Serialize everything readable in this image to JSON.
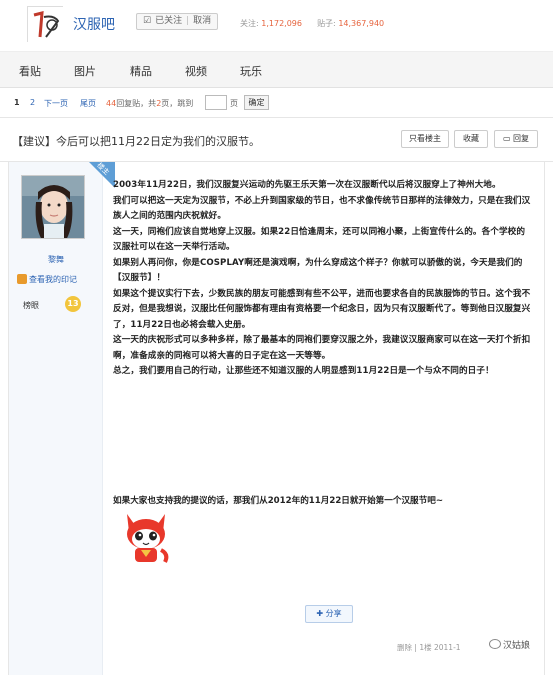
{
  "header": {
    "bar_name": "汉服吧",
    "follow_label": "已关注",
    "unfollow_label": "取消",
    "follow_count_label": "关注:",
    "follow_count": "1,172,096",
    "post_count_label": "贴子:",
    "post_count": "14,367,940",
    "logo_text": "汉服"
  },
  "nav": {
    "tabs": [
      {
        "label": "看贴"
      },
      {
        "label": "图片"
      },
      {
        "label": "精品"
      },
      {
        "label": "视频"
      },
      {
        "label": "玩乐"
      }
    ]
  },
  "pager": {
    "page1": "1",
    "page2": "2",
    "next": "下一页",
    "last": "尾页",
    "reply_count": "44",
    "reply_suffix": "回复贴，共",
    "total_pages": "2",
    "pages_suffix": "页，跳到",
    "page_unit": "页",
    "go_label": "确定"
  },
  "post": {
    "title": "【建议】今后可以把11月22日定为我们的汉服节。",
    "actions": {
      "only_op": "只看楼主",
      "favorite": "收藏",
      "reply": "回复"
    },
    "author": {
      "name": "黎舞",
      "footprint": "查看我的印记",
      "level_title": "榜眼",
      "level_number": "13",
      "badge": "楼主"
    },
    "paragraphs": [
      "2003年11月22日，我们汉服复兴运动的先驱王乐天第一次在汉服断代以后将汉服穿上了神州大地。",
      "我们可以把这一天定为汉服节，不必上升到国家级的节日，也不求像传统节日那样的法律效力，只是在我们汉族人之间的范围内庆祝就好。",
      "这一天，同袍们应该自觉地穿上汉服。如果22日恰逢周末，还可以同袍小聚，上街宣传什么的。各个学校的汉服社可以在这一天举行活动。",
      "如果别人再问你，你是COSPLAY啊还是演戏啊，为什么穿成这个样子？你就可以骄傲的说，今天是我们的【汉服节】！",
      "如果这个提议实行下去，少数民族的朋友可能感到有些不公平，进而也要求各自的民族服饰的节日。这个我不反对，但是我想说，汉服比任何服饰都有理由有资格要一个纪念日，因为只有汉服断代了。等到他日汉服复兴了，11月22日也必将会载入史册。",
      "这一天的庆祝形式可以多种多样，除了最基本的同袍们要穿汉服之外，我建议汉服商家可以在这一天打个折扣啊，准备成亲的同袍可以将大喜的日子定在这一天等等。",
      "总之，我们要用自己的行动，让那些还不知道汉服的人明显感到11月22日是一个与众不同的日子！"
    ],
    "closing": "如果大家也支持我的提议的话，那我们从2012年的11月22日就开始第一个汉服节吧~",
    "share_label": "分享",
    "delete_label": "删除",
    "floor": "1楼",
    "date": "2011-1",
    "watermark": "汉姑娘"
  },
  "colors": {
    "link": "#2d64b3",
    "count": "#e6643e",
    "ribbon": "#5e9ed6"
  }
}
